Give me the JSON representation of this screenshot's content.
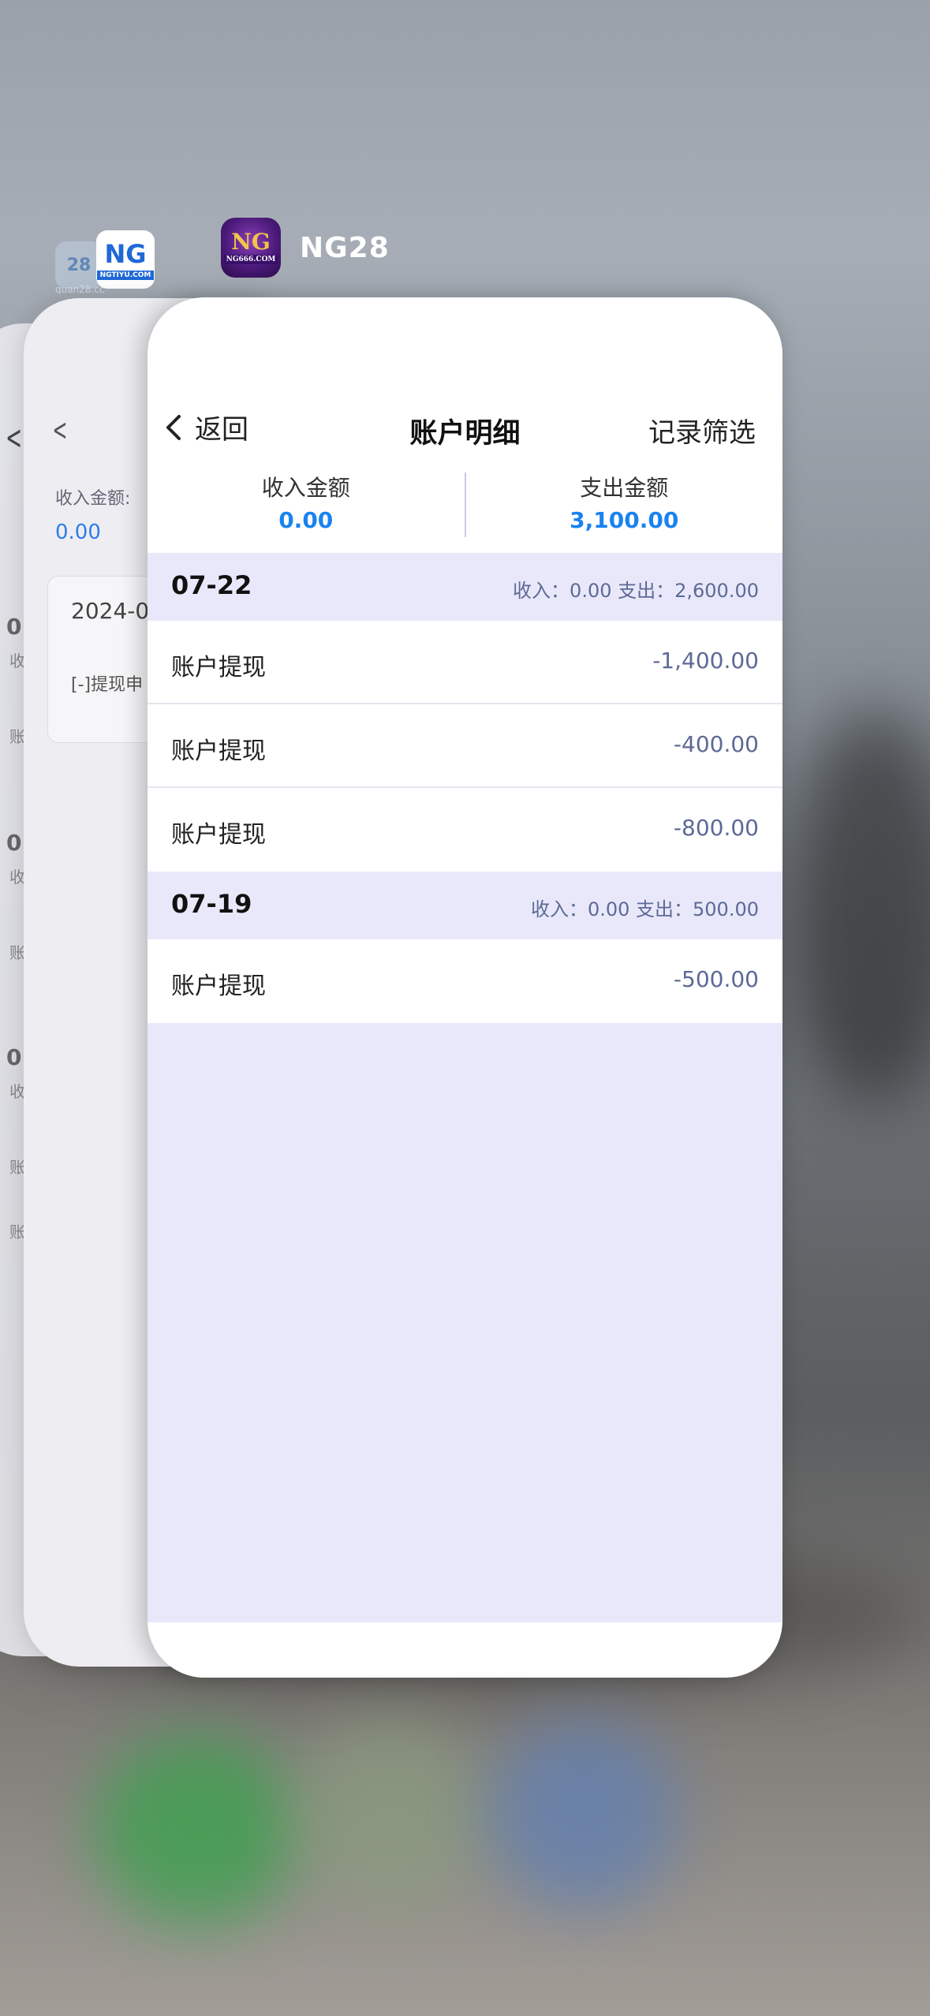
{
  "switcher": {
    "app_name": "NG28",
    "main_icon": {
      "name": "ng666-app-icon",
      "text": "NG",
      "sub": "NG666.COM"
    },
    "other_icons": [
      {
        "name": "ngtiyu-app-icon",
        "text": "NG",
        "sub": "NGTIYU.COM"
      },
      {
        "name": "quan28-app-icon",
        "text": "28",
        "sub": "quan28.cc"
      }
    ]
  },
  "back_card": {
    "income_label": "收入金额:",
    "income_value": "0.00",
    "date": "2024-0",
    "note": "[-]提现申",
    "edge_letters": [
      "0",
      "0",
      "0"
    ],
    "edge_subs": [
      "收",
      "收",
      "收"
    ],
    "edge_rows": [
      "账",
      "账",
      "账",
      "账"
    ]
  },
  "header": {
    "back_label": "返回",
    "title": "账户明细",
    "filter_label": "记录筛选"
  },
  "summary": {
    "income_label": "收入金额",
    "income_value": "0.00",
    "expense_label": "支出金额",
    "expense_value": "3,100.00"
  },
  "groups": [
    {
      "date": "07-22",
      "summary": "收入：0.00 支出：2,600.00",
      "rows": [
        {
          "name": "账户提现",
          "amount": "-1,400.00"
        },
        {
          "name": "账户提现",
          "amount": "-400.00"
        },
        {
          "name": "账户提现",
          "amount": "-800.00"
        }
      ]
    },
    {
      "date": "07-19",
      "summary": "收入：0.00 支出：500.00",
      "rows": [
        {
          "name": "账户提现",
          "amount": "-500.00"
        }
      ]
    }
  ],
  "colors": {
    "accent_blue": "#1a82f0",
    "amount_color": "#5d6a96",
    "group_bg": "#e8e8fa"
  }
}
